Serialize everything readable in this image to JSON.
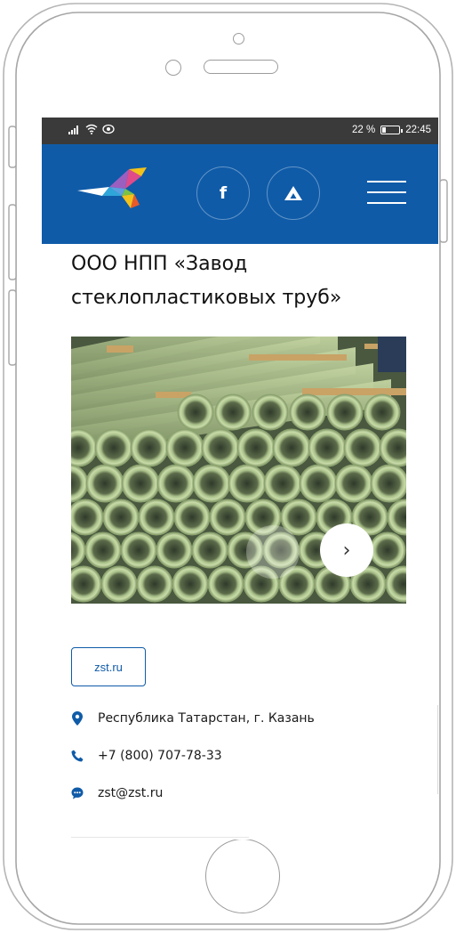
{
  "status_bar": {
    "battery_text": "22 %",
    "time": "22:45",
    "battery_level": 0.22,
    "icons": [
      "signal-icon",
      "wifi-icon",
      "eye-icon"
    ]
  },
  "header": {
    "background_color": "#0f5ba8",
    "logo": "bird-logo",
    "social": [
      {
        "icon": "facebook-icon",
        "label": "f"
      },
      {
        "icon": "triangle-icon",
        "label": ""
      }
    ],
    "menu_icon": "hamburger-icon"
  },
  "company": {
    "title": "ООО НПП «Завод стеклопластиковых труб»"
  },
  "gallery": {
    "image": "fiberglass-pipes-photo",
    "prev_icon": "chevron-left-icon",
    "next_icon": "chevron-right-icon",
    "next_glyph": "›"
  },
  "website_button": {
    "label": "zst.ru"
  },
  "contacts": {
    "address": "Республика Татарстан, г. Казань",
    "phone": "+7 (800) 707-78-33",
    "email": "zst@zst.ru"
  },
  "colors": {
    "brand_blue": "#0f5ba8",
    "status_bar": "#3a3a3a"
  }
}
